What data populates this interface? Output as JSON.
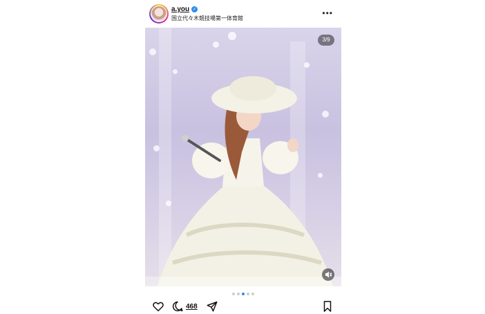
{
  "header": {
    "username": "a.you",
    "location": "国立代々木競技場第一体育館"
  },
  "media": {
    "counter": "3/9",
    "current_slide": 3,
    "total_slides": 9,
    "carousel_dots": 5,
    "active_dot": 3
  },
  "actions": {
    "comment_count": "468"
  },
  "colors": {
    "verified": "#2e8bea",
    "active_dot": "#3b82f6"
  }
}
